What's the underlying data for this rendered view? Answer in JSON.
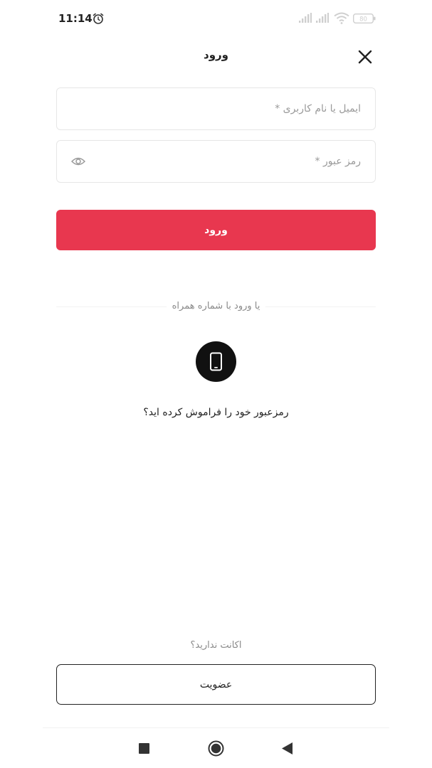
{
  "status_bar": {
    "time": "11:14",
    "battery_level": "80"
  },
  "header": {
    "title": "ورود"
  },
  "form": {
    "username_placeholder": "ایمیل یا نام کاربری *",
    "username_value": "",
    "password_placeholder": "رمز عبور *",
    "password_value": "",
    "login_label": "ورود"
  },
  "alt_login": {
    "divider_text": "یا ورود با شماره همراه",
    "forgot_password": "رمزعبور خود را فراموش کرده اید؟"
  },
  "signup": {
    "prompt": "اکانت ندارید؟",
    "button_label": "عضویت"
  },
  "colors": {
    "primary": "#e8374f",
    "phone_button": "#111111"
  }
}
